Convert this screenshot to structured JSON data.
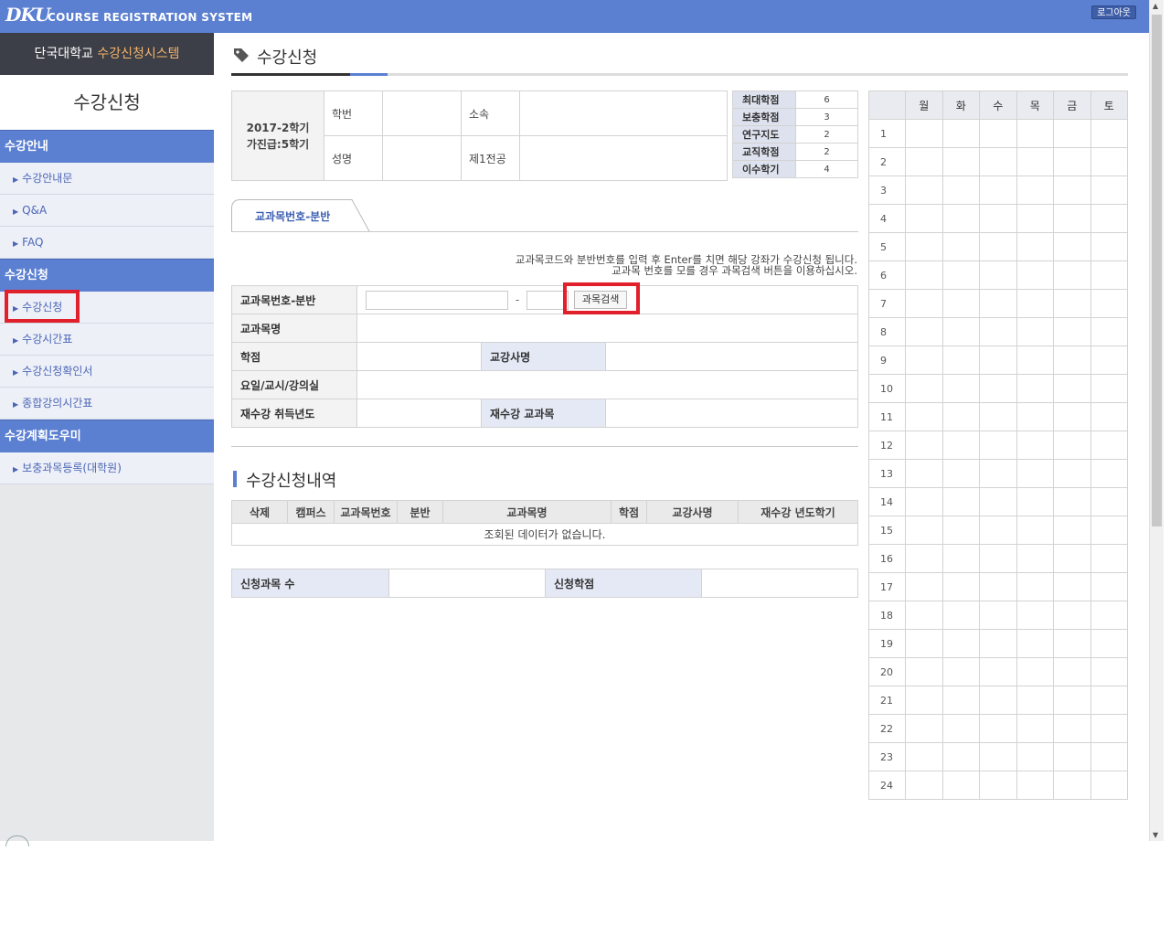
{
  "header": {
    "logo": "DKU",
    "system_title": "COURSE REGISTRATION SYSTEM",
    "logout": "로그아웃"
  },
  "sidebar": {
    "school": "단국대학교",
    "system_name": "수강신청시스템",
    "title": "수강신청",
    "sections": [
      {
        "heading": "수강안내",
        "items": [
          "수강안내문",
          "Q&A",
          "FAQ"
        ]
      },
      {
        "heading": "수강신청",
        "items": [
          "수강신청",
          "수강시간표",
          "수강신청확인서",
          "종합강의시간표"
        ]
      },
      {
        "heading": "수강계획도우미",
        "items": [
          "보충과목등록(대학원)"
        ]
      }
    ],
    "active_item": "수강신청"
  },
  "main": {
    "page_title": "수강신청",
    "student": {
      "semester": "2017-2학기",
      "grade": "가진급:5학기",
      "student_no_label": "학번",
      "student_no_value": "",
      "affiliation_label": "소속",
      "affiliation_value": "",
      "name_label": "성명",
      "name_value": "",
      "major_label": "제1전공",
      "major_value": ""
    },
    "credits": [
      {
        "label": "최대학점",
        "value": "6"
      },
      {
        "label": "보충학점",
        "value": "3"
      },
      {
        "label": "연구지도",
        "value": "2"
      },
      {
        "label": "교직학점",
        "value": "2"
      },
      {
        "label": "이수학기",
        "value": "4"
      }
    ],
    "tab_label": "교과목번호-분반",
    "instructions": [
      "교과목코드와 분반번호를 입력 후 Enter를 치면 해당 강좌가 수강신청 됩니다.",
      "교과목 번호를 모를 경우 과목검색 버튼을 이용하십시오."
    ],
    "entry": {
      "code_label": "교과목번호-분반",
      "code_value": "",
      "section_value": "",
      "dash": "-",
      "search_button": "과목검색",
      "course_name_label": "교과목명",
      "credit_label": "학점",
      "instructor_label": "교강사명",
      "schedule_label": "요일/교시/강의실",
      "retake_year_label": "재수강 취득년도",
      "retake_course_label": "재수강 교과목"
    },
    "list": {
      "title": "수강신청내역",
      "columns": [
        "삭제",
        "캠퍼스",
        "교과목번호",
        "분반",
        "교과목명",
        "학점",
        "교강사명",
        "재수강 년도학기"
      ],
      "empty_message": "조회된 데이터가 없습니다."
    },
    "summary": {
      "count_label": "신청과목 수",
      "count_value": "",
      "credit_label": "신청학점",
      "credit_value": ""
    }
  },
  "timetable": {
    "days": [
      "월",
      "화",
      "수",
      "목",
      "금",
      "토"
    ],
    "periods": [
      "1",
      "2",
      "3",
      "4",
      "5",
      "6",
      "7",
      "8",
      "9",
      "10",
      "11",
      "12",
      "13",
      "14",
      "15",
      "16",
      "17",
      "18",
      "19",
      "20",
      "21",
      "22",
      "23",
      "24"
    ]
  }
}
